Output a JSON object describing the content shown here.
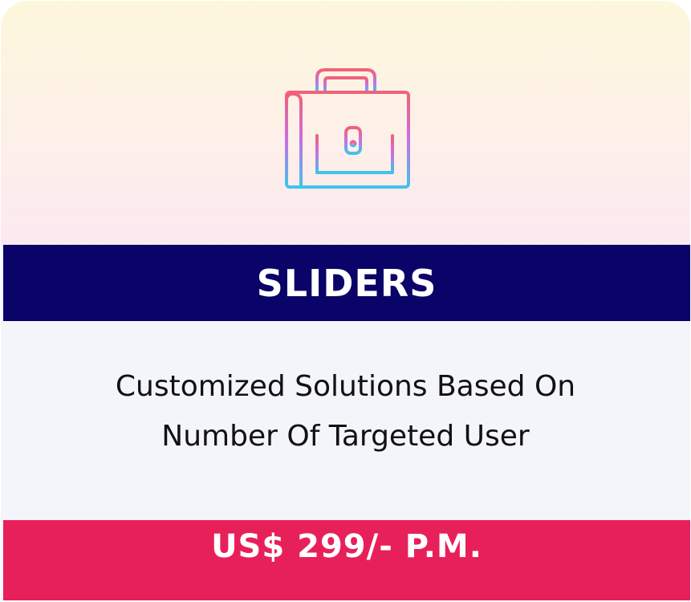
{
  "card": {
    "icon": "briefcase-icon",
    "title": "SLIDERS",
    "description_lines": [
      "Customized Solutions Based On",
      "Number Of Targeted User"
    ],
    "price": "US$ 299/- P.M."
  },
  "colors": {
    "title_band": "#0a0468",
    "price_band": "#e8205a",
    "icon_gradient_top": "#f2617a",
    "icon_gradient_mid": "#c86fe0",
    "icon_gradient_bottom": "#3fc4ef"
  }
}
